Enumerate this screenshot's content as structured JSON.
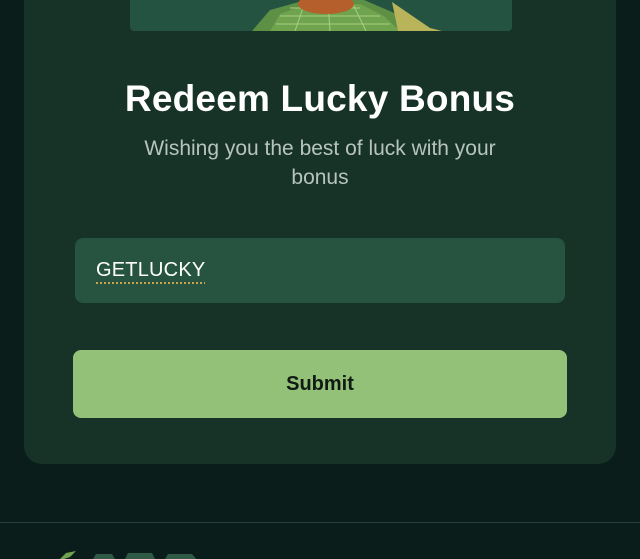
{
  "redeem_card": {
    "title": "Redeem Lucky Bonus",
    "subtitle": "Wishing you the best of luck with your bonus",
    "code_input": {
      "value": "GETLUCKY",
      "placeholder": ""
    },
    "submit_label": "Submit"
  },
  "colors": {
    "page_background": "#0b1d1a",
    "card_background": "#173327",
    "input_background": "#275441",
    "accent": "#94c178"
  },
  "icons": {
    "hero": "leprechaun-hat-illustration",
    "footer": "brand-logo-icon"
  }
}
